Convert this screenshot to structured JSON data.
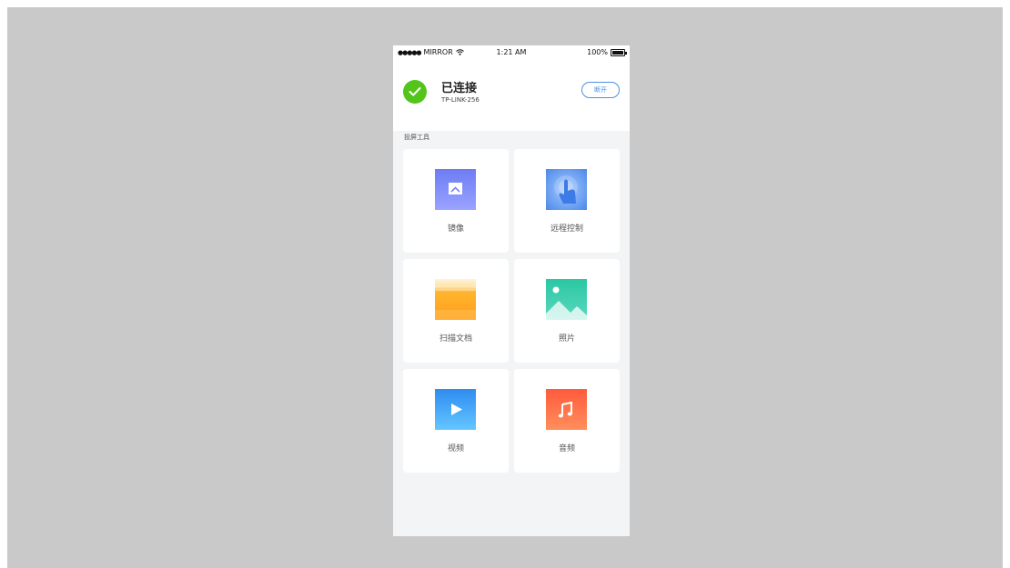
{
  "status_bar": {
    "carrier": "MIRROR",
    "signal_dots": "●●●●●",
    "time": "1:21 AM",
    "battery": "100%"
  },
  "connection": {
    "status": "已连接",
    "device": "TP-LINK-256",
    "disconnect_label": "断开"
  },
  "section_label": "投屏工具",
  "tools": [
    {
      "label": "镜像",
      "icon": "mirror-icon"
    },
    {
      "label": "远程控制",
      "icon": "remote-control-icon"
    },
    {
      "label": "扫描文档",
      "icon": "scan-document-icon"
    },
    {
      "label": "照片",
      "icon": "photo-icon"
    },
    {
      "label": "视频",
      "icon": "video-icon"
    },
    {
      "label": "音频",
      "icon": "audio-icon"
    }
  ],
  "colors": {
    "success": "#52c41a",
    "accent": "#4a90e2",
    "page_bg": "#f3f4f6",
    "backdrop": "#c9c9c9"
  }
}
